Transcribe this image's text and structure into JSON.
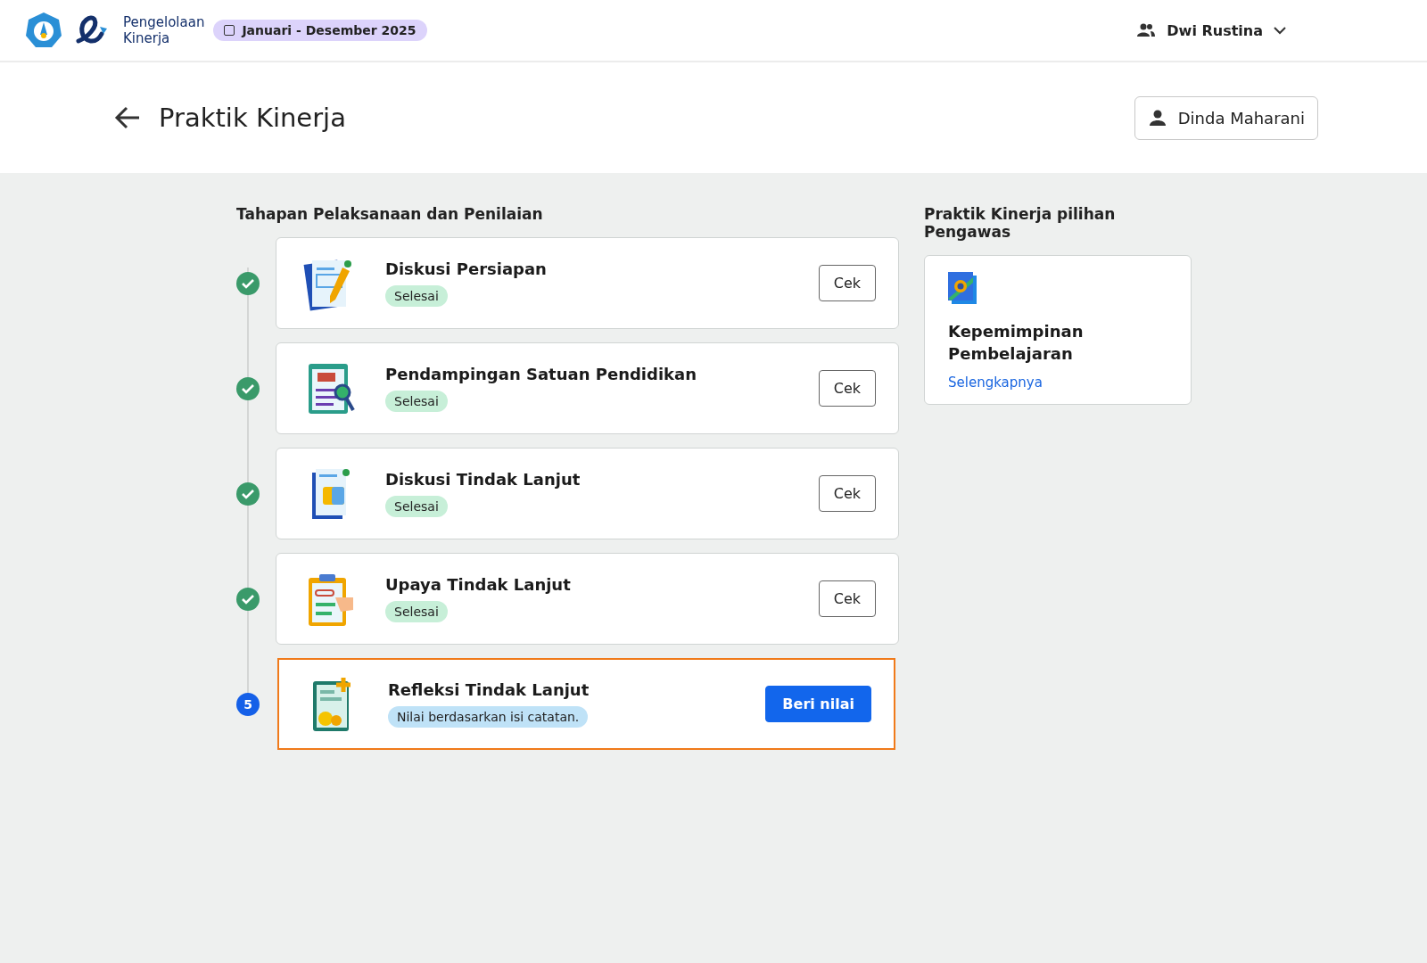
{
  "header": {
    "app_name_line1": "Pengelolaan",
    "app_name_line2": "Kinerja",
    "period": "Januari - Desember 2025",
    "user": "Dwi Rustina"
  },
  "page": {
    "title": "Praktik Kinerja",
    "person": "Dinda Maharani"
  },
  "stages": {
    "heading": "Tahapan Pelaksanaan dan Penilaian",
    "items": [
      {
        "title": "Diskusi Persiapan",
        "status": "Selesai",
        "completed": true,
        "selected": false,
        "button": {
          "label": "Cek",
          "kind": "outline"
        }
      },
      {
        "title": "Pendampingan Satuan Pendidikan",
        "status": "Selesai",
        "completed": true,
        "selected": false,
        "button": {
          "label": "Cek",
          "kind": "outline"
        }
      },
      {
        "title": "Diskusi Tindak Lanjut",
        "status": "Selesai",
        "completed": true,
        "selected": false,
        "button": {
          "label": "Cek",
          "kind": "outline"
        }
      },
      {
        "title": "Upaya Tindak Lanjut",
        "status": "Selesai",
        "completed": true,
        "selected": false,
        "button": {
          "label": "Cek",
          "kind": "outline"
        }
      },
      {
        "title": "Refleksi Tindak Lanjut",
        "status": "Nilai berdasarkan isi catatan.",
        "completed": false,
        "number": "5",
        "selected": true,
        "button": {
          "label": "Beri nilai",
          "kind": "primary"
        }
      }
    ]
  },
  "supervisor_choice": {
    "heading": "Praktik Kinerja pilihan Pengawas",
    "title": "Kepemimpinan Pembelajaran",
    "link": "Selengkapnya"
  }
}
